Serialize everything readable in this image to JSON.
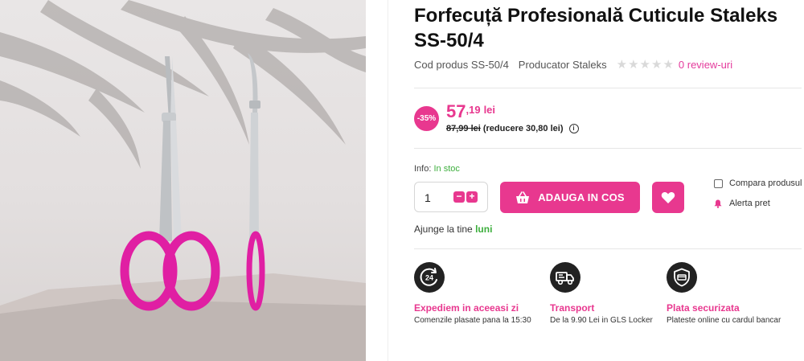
{
  "product": {
    "title": "Forfecuță Profesională Cuticule Staleks SS-50/4",
    "code_label": "Cod produs SS-50/4",
    "producer_label": "Producator Staleks",
    "rating": 0,
    "reviews_label": "0 review-uri"
  },
  "pricing": {
    "discount_badge": "-35%",
    "price_int": "57",
    "price_dec": ",19",
    "currency": "lei",
    "old_price": "87,99 lei",
    "reduction": "(reducere 30,80 lei)",
    "info_icon": "i"
  },
  "stock": {
    "label": "Info:",
    "status": "In stoc"
  },
  "purchase": {
    "quantity": "1",
    "minus": "−",
    "plus": "+",
    "add_to_cart": "ADAUGA IN COS",
    "compare": "Compara produsul",
    "price_alert": "Alerta pret"
  },
  "delivery": {
    "label": "Ajunge la tine",
    "day": "luni"
  },
  "features": [
    {
      "icon": "clock-24-icon",
      "title": "Expediem in aceeasi zi",
      "subtitle": "Comenzile plasate pana la 15:30"
    },
    {
      "icon": "truck-icon",
      "title": "Transport",
      "subtitle": "De la 9.90 Lei in GLS Locker"
    },
    {
      "icon": "shield-check-icon",
      "title": "Plata securizata",
      "subtitle": "Plateste online cu cardul bancar"
    }
  ],
  "colors": {
    "accent": "#e8388f",
    "in_stock": "#3cae3c",
    "icon_dark": "#222222"
  }
}
